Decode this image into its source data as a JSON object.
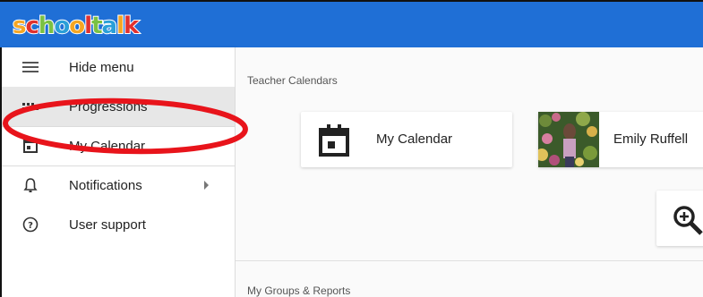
{
  "app": {
    "logo_letters": [
      "s",
      "c",
      "h",
      "o",
      "o",
      "l",
      "t",
      "a",
      "l",
      "k"
    ],
    "logo_colors": [
      "#f5a623",
      "#e0312f",
      "#7ac143",
      "#2a9fd8",
      "#f5a623",
      "#e0312f",
      "#7ac143",
      "#2a9fd8",
      "#f5a623",
      "#e0312f"
    ],
    "brand_color": "#1f6fd6"
  },
  "sidebar": {
    "items": [
      {
        "label": "Hide menu",
        "icon": "menu-icon"
      },
      {
        "label": "Progressions",
        "icon": "grid-icon"
      },
      {
        "label": "My Calendar",
        "icon": "calendar-icon"
      },
      {
        "label": "Notifications",
        "icon": "bell-icon"
      },
      {
        "label": "User support",
        "icon": "help-icon"
      }
    ]
  },
  "main": {
    "teacher_calendars_title": "Teacher Calendars",
    "cards": [
      {
        "label": "My Calendar",
        "icon": "calendar-icon"
      },
      {
        "label": "Emily Ruffell",
        "icon": "avatar-photo"
      }
    ],
    "zoom_icon": "zoom-in-icon",
    "groups_title": "My Groups & Reports"
  },
  "annotation": {
    "color": "#e8141b",
    "shape": "red-ellipse-highlight"
  }
}
